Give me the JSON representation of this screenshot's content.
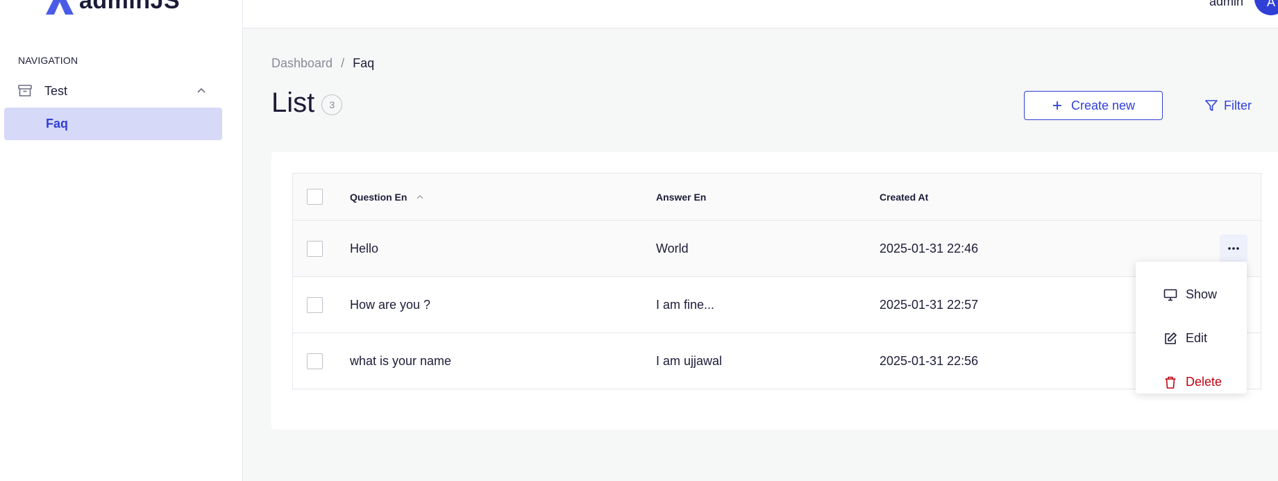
{
  "brand": {
    "logo_text": "adminJS"
  },
  "sidebar": {
    "heading": "NAVIGATION",
    "group": {
      "label": "Test",
      "icon": "archive-icon"
    },
    "items": [
      {
        "label": "Faq",
        "active": true
      }
    ]
  },
  "topbar": {
    "user_name": "admin",
    "avatar_initial": "A"
  },
  "breadcrumb": {
    "items": [
      "Dashboard",
      "Faq"
    ],
    "separator": "/"
  },
  "page": {
    "title": "List",
    "count": "3"
  },
  "actions": {
    "create_label": "Create new",
    "filter_label": "Filter"
  },
  "table": {
    "columns": [
      "Question En",
      "Answer En",
      "Created At"
    ],
    "sort": {
      "column": "Question En",
      "direction": "asc"
    },
    "rows": [
      {
        "question": "Hello",
        "answer": "World",
        "created_at": "2025-01-31 22:46"
      },
      {
        "question": "How are you ?",
        "answer": "I am fine...",
        "created_at": "2025-01-31 22:57"
      },
      {
        "question": "what is your name",
        "answer": "I am ujjawal",
        "created_at": "2025-01-31 22:56"
      }
    ]
  },
  "row_menu": {
    "items": [
      {
        "label": "Show",
        "icon": "monitor-icon"
      },
      {
        "label": "Edit",
        "icon": "edit-icon"
      },
      {
        "label": "Delete",
        "icon": "trash-icon",
        "danger": true
      }
    ]
  },
  "colors": {
    "primary": "#3040d6",
    "active_bg": "#d6d9f7",
    "danger": "#c20012",
    "text": "#1c1c38",
    "muted": "#898a9a"
  }
}
